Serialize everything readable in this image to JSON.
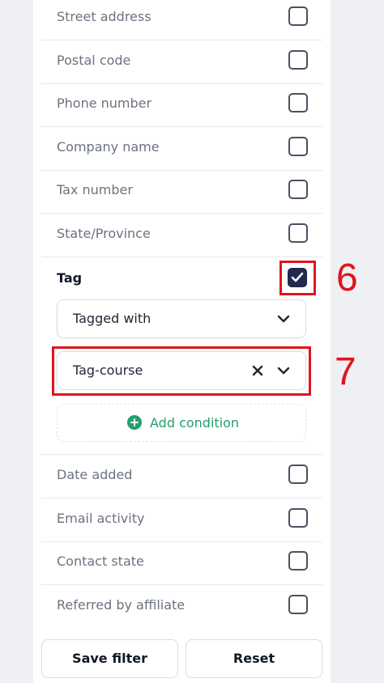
{
  "fields_top": [
    {
      "label": "Street address",
      "checked": false
    },
    {
      "label": "Postal code",
      "checked": false
    },
    {
      "label": "Phone number",
      "checked": false
    },
    {
      "label": "Company name",
      "checked": false
    },
    {
      "label": "Tax number",
      "checked": false
    },
    {
      "label": "State/Province",
      "checked": false
    }
  ],
  "tag": {
    "label": "Tag",
    "checked": true,
    "condition": "Tagged with",
    "value": "Tag-course",
    "add_condition": "Add condition"
  },
  "fields_bottom": [
    {
      "label": "Date added",
      "checked": false
    },
    {
      "label": "Email activity",
      "checked": false
    },
    {
      "label": "Contact state",
      "checked": false
    },
    {
      "label": "Referred by affiliate",
      "checked": false
    }
  ],
  "annotations": {
    "checkbox_step": "6",
    "select_step": "7"
  },
  "buttons": {
    "save": "Save filter",
    "reset": "Reset"
  },
  "colors": {
    "accent_green": "#22a06b",
    "checkbox_fill": "#1f2a4d",
    "annotation_red": "#e3131b"
  }
}
